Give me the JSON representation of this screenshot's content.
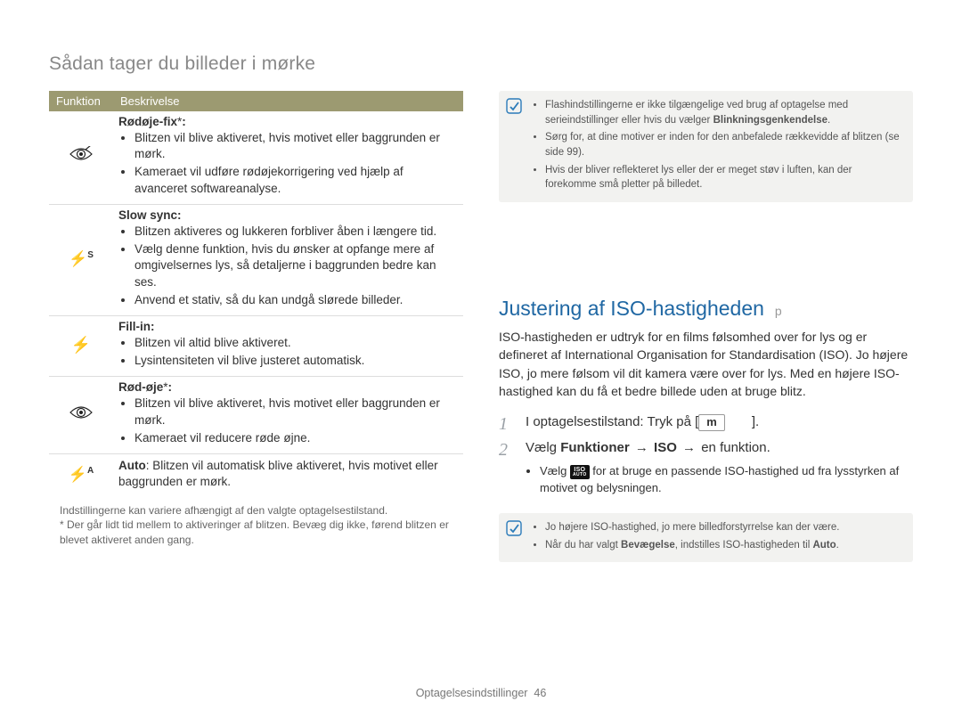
{
  "page_title": "Sådan tager du billeder i mørke",
  "table": {
    "head_function": "Funktion",
    "head_description": "Beskrivelse",
    "rows": [
      {
        "icon": "👁",
        "title": "Rødøje-fix",
        "star": "*",
        "bullets": [
          "Blitzen vil blive aktiveret, hvis motivet eller baggrunden er mørk.",
          "Kameraet vil udføre rødøjekorrigering ved hjælp af avanceret softwareanalyse."
        ]
      },
      {
        "icon": "⚡S",
        "title": "Slow sync",
        "star": "",
        "bullets": [
          "Blitzen aktiveres og lukkeren forbliver åben i længere tid.",
          "Vælg denne funktion, hvis du ønsker at opfange mere af omgivelsernes lys, så detaljerne i baggrunden bedre kan ses.",
          "Anvend et stativ, så du kan undgå slørede billeder."
        ]
      },
      {
        "icon": "⚡",
        "title": "Fill-in",
        "star": "",
        "bullets": [
          "Blitzen vil altid blive aktiveret.",
          "Lysintensiteten vil blive justeret automatisk."
        ]
      },
      {
        "icon": "👁",
        "title": "Rød-øje",
        "star": "*",
        "bullets": [
          "Blitzen vil blive aktiveret, hvis motivet eller baggrunden er mørk.",
          "Kameraet vil reducere røde øjne."
        ]
      }
    ],
    "auto_row": {
      "icon": "⚡A",
      "bold": "Auto",
      "text": ": Blitzen vil automatisk blive aktiveret, hvis motivet eller baggrunden er mørk."
    }
  },
  "footnote1": "Indstillingerne kan variere afhængigt af den valgte optagelsestilstand.",
  "footnote2": "* Der går lidt tid mellem to aktiveringer af blitzen. Bevæg dig ikke, førend blitzen er blevet aktiveret anden gang.",
  "top_note": {
    "bullets": [
      "Flashindstillingerne er ikke tilgængelige ved brug af optagelse med serieindstillinger eller hvis du vælger Blinkningsgenkendelse.",
      "Sørg for, at dine motiver er inden for den anbefalede rækkevidde af blitzen (se side 99).",
      "Hvis der bliver reflekteret lys eller der er meget støv i luften, kan der forekomme små pletter på billedet."
    ],
    "bold_word": "Blinkningsgenkendelse"
  },
  "heading": "Justering af ISO-hastigheden",
  "mode_badge": "p",
  "intro": "ISO-hastigheden er udtryk for en films følsomhed over for lys og er defineret af International Organisation for Standardisation (ISO). Jo højere ISO, jo mere følsom vil dit kamera være over for lys. Med en højere ISO-hastighed kan du få et bedre billede uden at bruge blitz.",
  "steps": {
    "s1_pre": "I optagelsestilstand: Tryk på [",
    "s1_btn": "m",
    "s1_post": "].",
    "s2_pre": "Vælg ",
    "s2_b1": "Funktioner",
    "s2_arrow": " → ",
    "s2_b2": "ISO",
    "s2_post": " → en funktion.",
    "sub_pre": "Vælg ",
    "sub_post": " for at bruge en passende ISO-hastighed ud fra lysstyrken af motivet og belysningen."
  },
  "bottom_note": {
    "b1": "Jo højere ISO-hastighed, jo mere billedforstyrrelse kan der være.",
    "b2_pre": "Når du har valgt ",
    "b2_bold": "Bevægelse",
    "b2_mid": ", indstilles ISO-hastigheden til ",
    "b2_bold2": "Auto",
    "b2_post": "."
  },
  "footer_label": "Optagelsesindstillinger",
  "footer_page": "46"
}
